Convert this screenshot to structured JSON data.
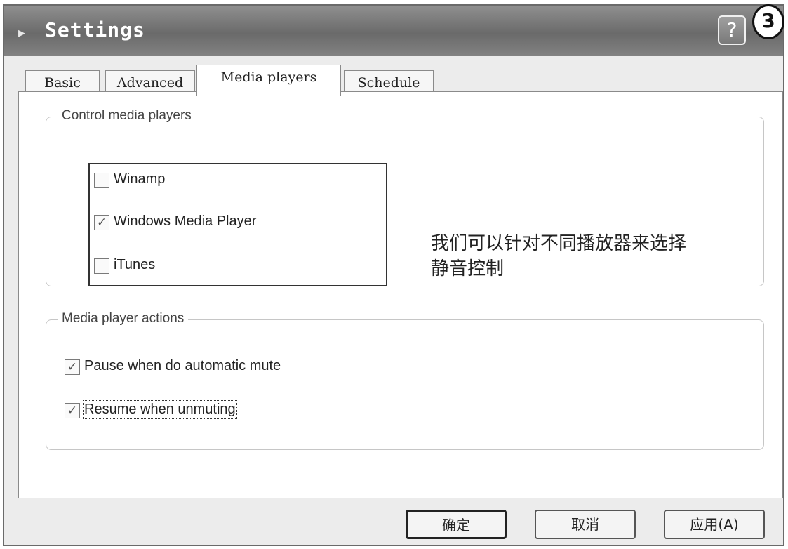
{
  "window": {
    "title": "Settings",
    "title_icon": "app-icon",
    "help_label": "?",
    "badge": "3"
  },
  "tabs": [
    {
      "label": "Basic",
      "active": false
    },
    {
      "label": "Advanced",
      "active": false
    },
    {
      "label": "Media players",
      "active": true
    },
    {
      "label": "Schedule",
      "active": false
    }
  ],
  "control_group": {
    "label": "Control media players",
    "players": [
      {
        "label": "Winamp",
        "checked": false
      },
      {
        "label": "Windows Media Player",
        "checked": true
      },
      {
        "label": "iTunes",
        "checked": false
      }
    ],
    "note_line1": "我们可以针对不同播放器来选择",
    "note_line2": "静音控制"
  },
  "actions_group": {
    "label": "Media player actions",
    "options": [
      {
        "label": "Pause when do automatic mute",
        "checked": true
      },
      {
        "label": "Resume when unmuting",
        "checked": true
      }
    ]
  },
  "buttons": {
    "ok": "确定",
    "cancel": "取消",
    "apply": "应用(A)"
  },
  "check_mark": "✓"
}
